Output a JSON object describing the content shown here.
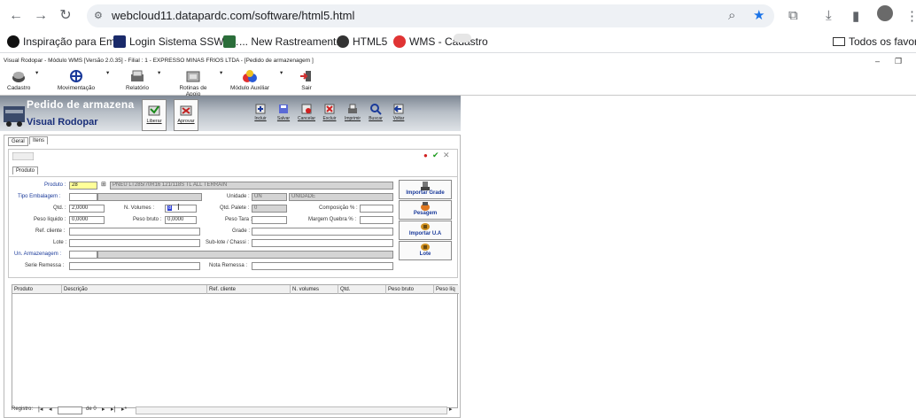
{
  "browser": {
    "url": "webcloud11.datapardc.com/software/html5.html",
    "bookmarks": [
      {
        "label": "Inspiração para Em...",
        "color": "#111111"
      },
      {
        "label": "Login Sistema SSW :...",
        "color": "#1a2a6a"
      },
      {
        "label": "... New Rastreament...",
        "color": "#2b6e3a"
      },
      {
        "label": "HTML5",
        "color": "#333333"
      },
      {
        "label": "WMS - Cadastro",
        "color": "#e03434"
      }
    ],
    "all_favorites": "Todos os favorito"
  },
  "app": {
    "title": "Visual Rodopar - Módulo WMS [Versão 2.0.35] - Filial : 1 - EXPRESSO MINAS FRIOS LTDA - [Pedido de armazenagem ]",
    "toolbar": [
      {
        "label": "Cadastro",
        "icon": "cadastro-icon",
        "arrow": true
      },
      {
        "label": "Movimentação",
        "icon": "movimentacao-icon",
        "arrow": true
      },
      {
        "label": "Relatório",
        "icon": "relatorio-icon",
        "arrow": true
      },
      {
        "label": "Rotinas de Apoio",
        "icon": "rotinas-icon",
        "arrow": true
      },
      {
        "label": "Módulo Auxiliar",
        "icon": "modulo-icon",
        "arrow": true
      },
      {
        "label": "Sair",
        "icon": "exit-icon",
        "arrow": false
      }
    ]
  },
  "header": {
    "title": "Pedido de armazena",
    "subtitle": "Visual Rodopar",
    "big_buttons": [
      "Liberar",
      "Aprovar"
    ],
    "actions": [
      "Incluir",
      "Salvar",
      "Cancelar",
      "Excluir",
      "Imprimir",
      "Buscar",
      "Voltar"
    ]
  },
  "form": {
    "tabs": [
      "Geral",
      "Itens"
    ],
    "inner_tab": "Produto",
    "fields": {
      "produto_label": "Produto :",
      "produto_code": "28",
      "produto_desc": "PNEU LT285/70R16 121/118S TL ALL TERRAIN",
      "tipo_embalagem_label": "Tipo Embalagem :",
      "unidade_label": "Unidade :",
      "unidade_code": "UN",
      "unidade_desc": "UNIDADE",
      "qtd_label": "Qtd. :",
      "qtd_value": "2,0000",
      "n_volumes_label": "N. Volumes :",
      "n_volumes_value": "8",
      "qtd_palete_label": "Qtd. Palete :",
      "qtd_palete_value": "0",
      "composicao_label": "Composição % :",
      "peso_liquido_label": "Peso líquido :",
      "peso_liquido_value": "0,0000",
      "peso_bruto_label": "Peso bruto :",
      "peso_bruto_value": "0,0000",
      "peso_tara_label": "Peso Tara :",
      "margem_quebra_label": "Margem Quebra % :",
      "ref_cliente_label": "Ref. cliente :",
      "grade_label": "Grade :",
      "lote_label": "Lote :",
      "sublote_label": "Sub-lote / Chassi :",
      "un_armazenagem_label": "Un. Armazenagem :",
      "serie_remessa_label": "Serie Remessa :",
      "nota_remessa_label": "Nota Remessa :"
    },
    "side_buttons": [
      "Importar Grade",
      "Pesagem",
      "Importar U.A",
      "Lote"
    ],
    "grid_columns": [
      "Produto",
      "Descrição",
      "Ref. cliente",
      "N. volumes",
      "Qtd.",
      "Peso bruto",
      "Peso líq"
    ],
    "navigator": {
      "label": "Registro:",
      "counter": "de 0"
    }
  }
}
